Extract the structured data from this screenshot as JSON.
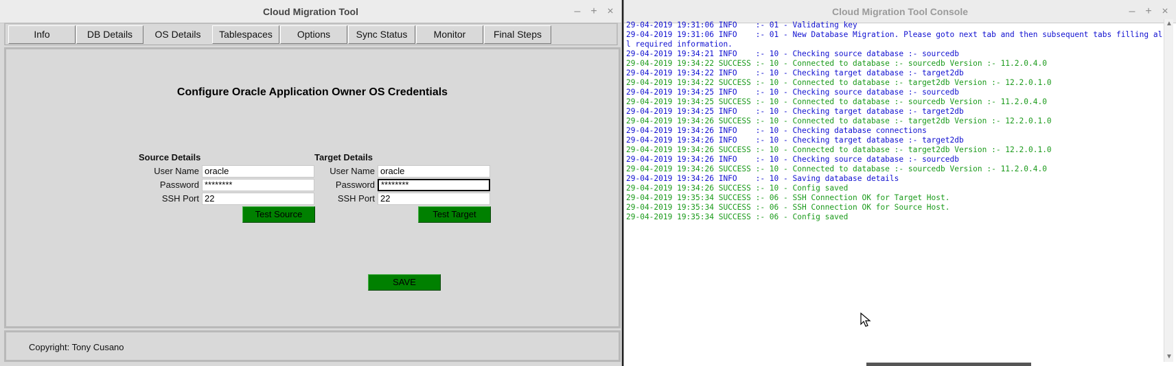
{
  "main_window": {
    "title": "Cloud Migration Tool",
    "controls": {
      "minimize": "–",
      "maximize": "+",
      "close": "×"
    },
    "tabs": [
      {
        "label": "Info"
      },
      {
        "label": "DB Details"
      },
      {
        "label": "OS Details",
        "active": true
      },
      {
        "label": "Tablespaces"
      },
      {
        "label": "Options"
      },
      {
        "label": "Sync Status"
      },
      {
        "label": "Monitor"
      },
      {
        "label": "Final Steps"
      }
    ],
    "heading": "Configure Oracle Application Owner OS Credentials",
    "source": {
      "title": "Source Details",
      "user_label": "User Name",
      "user_value": "oracle",
      "password_label": "Password",
      "password_value": "********",
      "port_label": "SSH Port",
      "port_value": "22",
      "test_label": "Test Source"
    },
    "target": {
      "title": "Target Details",
      "user_label": "User Name",
      "user_value": "oracle",
      "password_label": "Password",
      "password_value": "********",
      "port_label": "SSH Port",
      "port_value": "22",
      "test_label": "Test Target"
    },
    "save_label": "SAVE",
    "copyright": "Copyright: Tony Cusano",
    "button_color": "#008000"
  },
  "console_window": {
    "title": "Cloud Migration Tool Console",
    "colors": {
      "INFO": "#1010d0",
      "SUCCESS": "#1a9a1a"
    },
    "lines": [
      {
        "level": "INFO",
        "text": "29-04-2019 19:31:06 INFO    :- 01 - Validating key"
      },
      {
        "level": "INFO",
        "text": "29-04-2019 19:31:06 INFO    :- 01 - New Database Migration. Please goto next tab and then subsequent tabs filling all required information."
      },
      {
        "level": "INFO",
        "text": "29-04-2019 19:34:21 INFO    :- 10 - Checking source database :- sourcedb"
      },
      {
        "level": "SUCCESS",
        "text": "29-04-2019 19:34:22 SUCCESS :- 10 - Connected to database :- sourcedb Version :- 11.2.0.4.0"
      },
      {
        "level": "INFO",
        "text": "29-04-2019 19:34:22 INFO    :- 10 - Checking target database :- target2db"
      },
      {
        "level": "SUCCESS",
        "text": "29-04-2019 19:34:22 SUCCESS :- 10 - Connected to database :- target2db Version :- 12.2.0.1.0"
      },
      {
        "level": "INFO",
        "text": "29-04-2019 19:34:25 INFO    :- 10 - Checking source database :- sourcedb"
      },
      {
        "level": "SUCCESS",
        "text": "29-04-2019 19:34:25 SUCCESS :- 10 - Connected to database :- sourcedb Version :- 11.2.0.4.0"
      },
      {
        "level": "INFO",
        "text": "29-04-2019 19:34:25 INFO    :- 10 - Checking target database :- target2db"
      },
      {
        "level": "SUCCESS",
        "text": "29-04-2019 19:34:26 SUCCESS :- 10 - Connected to database :- target2db Version :- 12.2.0.1.0"
      },
      {
        "level": "INFO",
        "text": "29-04-2019 19:34:26 INFO    :- 10 - Checking database connections"
      },
      {
        "level": "INFO",
        "text": "29-04-2019 19:34:26 INFO    :- 10 - Checking target database :- target2db"
      },
      {
        "level": "SUCCESS",
        "text": "29-04-2019 19:34:26 SUCCESS :- 10 - Connected to database :- target2db Version :- 12.2.0.1.0"
      },
      {
        "level": "INFO",
        "text": "29-04-2019 19:34:26 INFO    :- 10 - Checking source database :- sourcedb"
      },
      {
        "level": "SUCCESS",
        "text": "29-04-2019 19:34:26 SUCCESS :- 10 - Connected to database :- sourcedb Version :- 11.2.0.4.0"
      },
      {
        "level": "INFO",
        "text": "29-04-2019 19:34:26 INFO    :- 10 - Saving database details"
      },
      {
        "level": "SUCCESS",
        "text": "29-04-2019 19:34:26 SUCCESS :- 10 - Config saved"
      },
      {
        "level": "SUCCESS",
        "text": "29-04-2019 19:35:34 SUCCESS :- 06 - SSH Connection OK for Target Host."
      },
      {
        "level": "SUCCESS",
        "text": "29-04-2019 19:35:34 SUCCESS :- 06 - SSH Connection OK for Source Host."
      },
      {
        "level": "SUCCESS",
        "text": "29-04-2019 19:35:34 SUCCESS :- 06 - Config saved"
      }
    ]
  }
}
